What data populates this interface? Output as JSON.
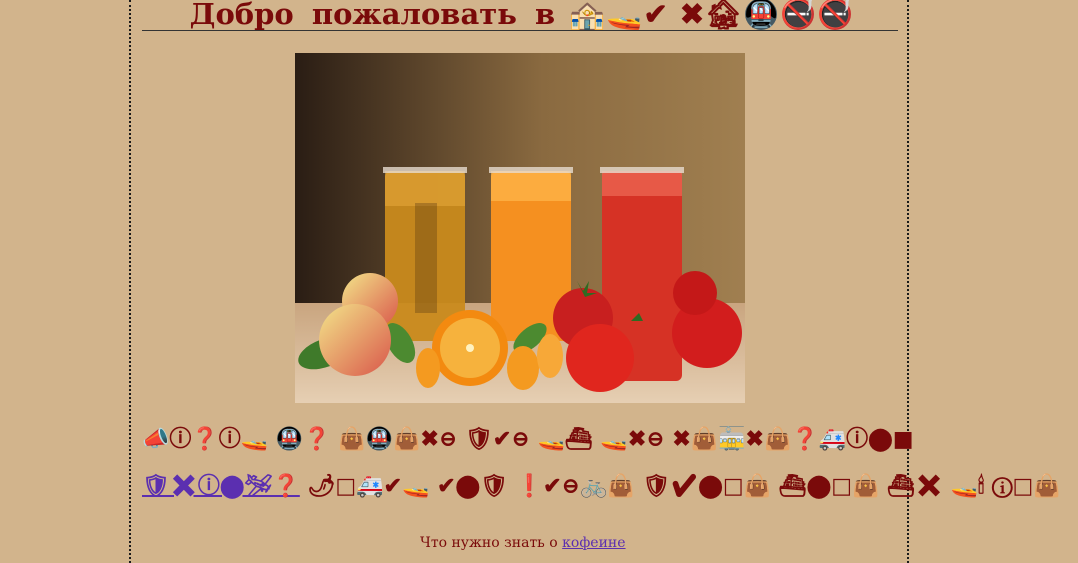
{
  "header": {
    "title_words": [
      "Добро",
      "пожаловать",
      "в"
    ],
    "title_icons": "🏤🚤✔ ✖🏚🚇🚭🚭"
  },
  "main": {
    "image": {
      "alt": "juice glasses with fruit",
      "caption": ""
    },
    "line1": "📣ⓘ❓ⓘ🚤 🚇❓  👜🚇👜✖⊖  🛡✔⊖  🚤⛴  🚤✖⊖  ✖👜🚋✖👜❓🚑ⓘ⬤■",
    "line2_link": "🛡✖ⓘ⬤🛩❓",
    "line2_rest": "🌶□🚑✔🚤  ✔⬤🛡  ❗✔⊖🚲👜  🛡✔⬤□👜  ⛴⬤□👜  ⛴✖  🚤🕯 ⓘ□👜"
  },
  "footer": {
    "text_words": [
      "Что",
      "нужно",
      "знать",
      "о"
    ],
    "link": "кофеине"
  },
  "colors": {
    "background": "#d2b48c",
    "text": "#7a0a0a",
    "link": "#5b2fb0"
  }
}
